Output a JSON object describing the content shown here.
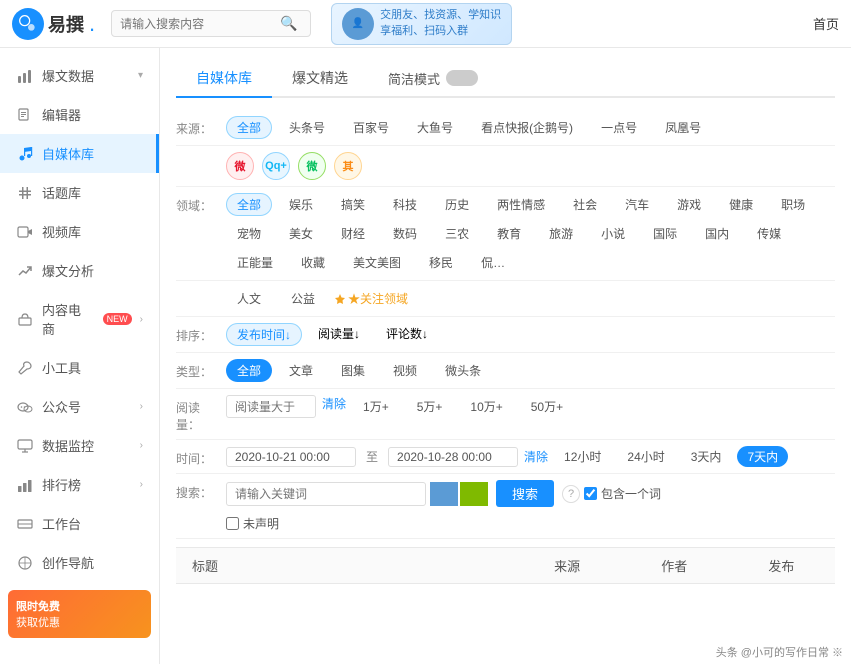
{
  "header": {
    "logo_text": "易撰",
    "logo_symbol": ".",
    "search_placeholder": "请输入搜索内容",
    "banner_line1": "交朋友、找资源、学知识",
    "banner_line2": "享福利、扫码入群",
    "nav_home": "首页"
  },
  "sidebar": {
    "items": [
      {
        "id": "bao-wen-data",
        "label": "爆文数据",
        "icon": "chart",
        "has_arrow": true,
        "active": false
      },
      {
        "id": "bian-ji-qi",
        "label": "编辑器",
        "icon": "edit",
        "has_arrow": false,
        "active": false
      },
      {
        "id": "zi-mei-ti-ku",
        "label": "自媒体库",
        "icon": "music",
        "has_arrow": false,
        "active": true
      },
      {
        "id": "hua-ti-ku",
        "label": "话题库",
        "icon": "hash",
        "has_arrow": false,
        "active": false
      },
      {
        "id": "shi-pin-ku",
        "label": "视频库",
        "icon": "video",
        "has_arrow": false,
        "active": false
      },
      {
        "id": "bao-wen-fen-xi",
        "label": "爆文分析",
        "icon": "trend",
        "has_arrow": false,
        "active": false
      },
      {
        "id": "nei-rong-dian-shang",
        "label": "内容电商",
        "icon": "shop",
        "has_arrow": true,
        "active": false,
        "badge": "NEW"
      },
      {
        "id": "xiao-gong-ju",
        "label": "小工具",
        "icon": "tool",
        "has_arrow": false,
        "active": false
      },
      {
        "id": "gong-zhong-hao",
        "label": "公众号",
        "icon": "wechat",
        "has_arrow": true,
        "active": false
      },
      {
        "id": "shu-ju-jian-kong",
        "label": "数据监控",
        "icon": "monitor",
        "has_arrow": true,
        "active": false
      },
      {
        "id": "pai-hang-bang",
        "label": "排行榜",
        "icon": "rank",
        "has_arrow": true,
        "active": false
      },
      {
        "id": "gong-zuo-tai",
        "label": "工作台",
        "icon": "desk",
        "has_arrow": false,
        "active": false
      },
      {
        "id": "chuang-zuo-dao-hang",
        "label": "创作导航",
        "icon": "nav",
        "has_arrow": false,
        "active": false
      }
    ]
  },
  "content": {
    "tabs": [
      {
        "id": "zi-mei-ti-ku",
        "label": "自媒体库",
        "active": true
      },
      {
        "id": "bao-wen-jing-xuan",
        "label": "爆文精选",
        "active": false
      },
      {
        "id": "jian-jie-mode",
        "label": "简洁模式",
        "active": false
      }
    ],
    "toggle_label": "简洁模式",
    "filters": {
      "source": {
        "label": "来源：",
        "options": [
          {
            "id": "all",
            "label": "全部",
            "active": true
          },
          {
            "id": "toutiao",
            "label": "头条号",
            "active": false
          },
          {
            "id": "baijia",
            "label": "百家号",
            "active": false
          },
          {
            "id": "dayu",
            "label": "大鱼号",
            "active": false
          },
          {
            "id": "kandian",
            "label": "看点快报(企鹅号)",
            "active": false
          },
          {
            "id": "yidian",
            "label": "一点号",
            "active": false
          },
          {
            "id": "fenghuang",
            "label": "凤凰号",
            "active": false
          }
        ],
        "icon_sources": [
          {
            "id": "weibo",
            "label": "微",
            "color": "#e6162d"
          },
          {
            "id": "qq",
            "label": "Qq+",
            "color": "#12b7f5"
          },
          {
            "id": "wechat",
            "label": "微",
            "color": "#07c160"
          },
          {
            "id": "other",
            "label": "其",
            "color": "#ff9800"
          }
        ]
      },
      "domain": {
        "label": "领域：",
        "options": [
          {
            "id": "all",
            "label": "全部",
            "active": true
          },
          {
            "id": "yule",
            "label": "娱乐",
            "active": false
          },
          {
            "id": "gaoxiao",
            "label": "搞笑",
            "active": false
          },
          {
            "id": "keji",
            "label": "科技",
            "active": false
          },
          {
            "id": "lishi",
            "label": "历史",
            "active": false
          },
          {
            "id": "liangxing",
            "label": "两性情感",
            "active": false
          },
          {
            "id": "shehui",
            "label": "社会",
            "active": false
          },
          {
            "id": "qiche",
            "label": "汽车",
            "active": false
          },
          {
            "id": "youxi",
            "label": "游戏",
            "active": false
          },
          {
            "id": "jiankang",
            "label": "健康",
            "active": false
          },
          {
            "id": "zhichang",
            "label": "职场",
            "active": false
          },
          {
            "id": "chongwu",
            "label": "宠物",
            "active": false
          },
          {
            "id": "meinu",
            "label": "美女",
            "active": false
          },
          {
            "id": "caijing",
            "label": "财经",
            "active": false
          },
          {
            "id": "shuma",
            "label": "数码",
            "active": false
          },
          {
            "id": "sannong",
            "label": "三农",
            "active": false
          },
          {
            "id": "jiaoyu",
            "label": "教育",
            "active": false
          },
          {
            "id": "lvyou",
            "label": "旅游",
            "active": false
          },
          {
            "id": "xiaoshuo",
            "label": "小说",
            "active": false
          },
          {
            "id": "guoji",
            "label": "国际",
            "active": false
          },
          {
            "id": "guonei",
            "label": "国内",
            "active": false
          },
          {
            "id": "chuanmei",
            "label": "传媒",
            "active": false
          },
          {
            "id": "zhengneng",
            "label": "正能量",
            "active": false
          },
          {
            "id": "shoucang",
            "label": "收藏",
            "active": false
          },
          {
            "id": "meiwenmei",
            "label": "美文美图",
            "active": false
          },
          {
            "id": "yimin",
            "label": "移民",
            "active": false
          },
          {
            "id": "other2",
            "label": "侃…",
            "active": false
          },
          {
            "id": "renwen",
            "label": "人文",
            "active": false
          },
          {
            "id": "gongyi",
            "label": "公益",
            "active": false
          }
        ],
        "attention_label": "★关注领域"
      },
      "sort": {
        "label": "排序：",
        "options": [
          {
            "id": "time",
            "label": "发布时间↓",
            "active": true
          },
          {
            "id": "read",
            "label": "阅读量↓",
            "active": false
          },
          {
            "id": "comment",
            "label": "评论数↓",
            "active": false
          }
        ]
      },
      "type": {
        "label": "类型：",
        "options": [
          {
            "id": "all",
            "label": "全部",
            "active": true
          },
          {
            "id": "article",
            "label": "文章",
            "active": false
          },
          {
            "id": "album",
            "label": "图集",
            "active": false
          },
          {
            "id": "video",
            "label": "视频",
            "active": false
          },
          {
            "id": "weitoutiao",
            "label": "微头条",
            "active": false
          }
        ]
      },
      "read_count": {
        "label": "阅读量：",
        "placeholder": "阅读量大于",
        "clear_label": "清除",
        "options": [
          "1万+",
          "5万+",
          "10万+",
          "50万+"
        ]
      },
      "time_range": {
        "label": "时间：",
        "start": "2020-10-21 00:00",
        "end": "2020-10-28 00:00",
        "sep": "至",
        "clear_label": "清除",
        "options": [
          {
            "id": "12h",
            "label": "12小时",
            "active": false
          },
          {
            "id": "24h",
            "label": "24小时",
            "active": false
          },
          {
            "id": "3d",
            "label": "3天内",
            "active": false
          },
          {
            "id": "7d",
            "label": "7天内",
            "active": true
          }
        ]
      },
      "search": {
        "label": "搜索：",
        "placeholder": "请输入关键词",
        "submit_label": "搜索",
        "help_label": "?",
        "checkbox_label": "包含一个词",
        "undeclared_label": "未声明"
      }
    },
    "table": {
      "columns": [
        "标题",
        "来源",
        "作者",
        "发布"
      ]
    }
  },
  "watermark": "头条 @小可的写作日常 ※"
}
